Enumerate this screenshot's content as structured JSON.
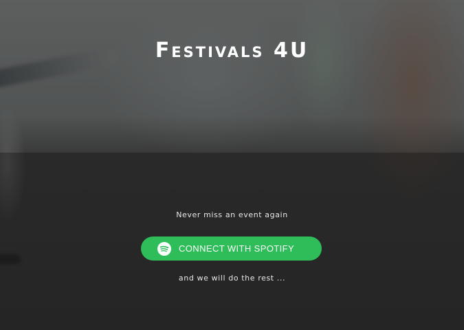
{
  "hero": {
    "title": "Festivals 4U"
  },
  "main": {
    "tagline": "Never miss an event again",
    "connect_button_label": "CONNECT WITH SPOTIFY",
    "connect_button_icon": "spotify-icon",
    "subline": "and we will do the rest ..."
  },
  "colors": {
    "spotify_green": "#2ebd59",
    "text": "#ffffff"
  }
}
